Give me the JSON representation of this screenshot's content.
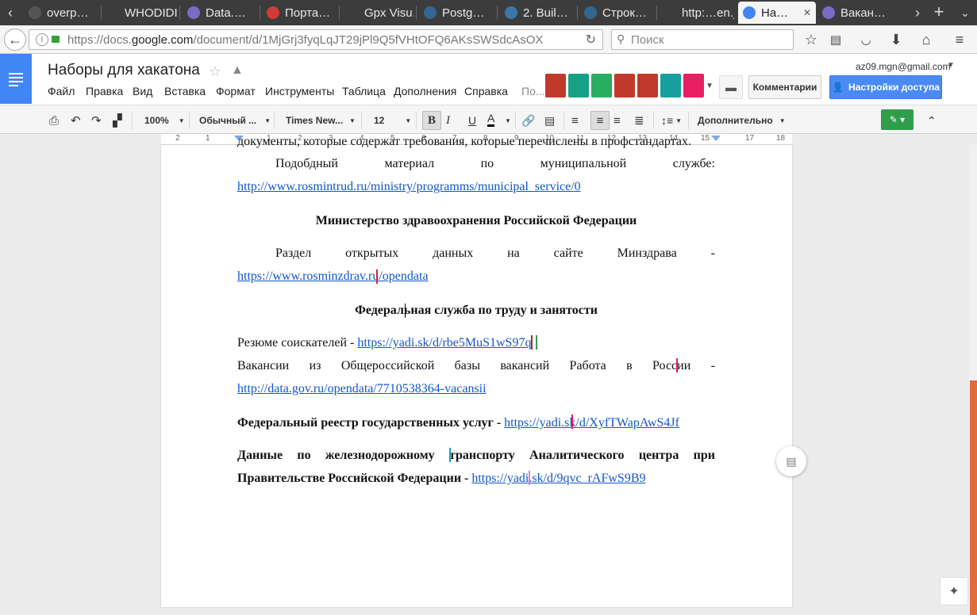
{
  "browser": {
    "tabs": [
      {
        "label": "overp…",
        "color": "#555555"
      },
      {
        "label": "WHODIDI…",
        "color": "#3c3c3c"
      },
      {
        "label": "Data.…",
        "color": "#7a6cc5"
      },
      {
        "label": "Порта…",
        "color": "#d33a3a"
      },
      {
        "label": "Gpx Visu…",
        "color": "#3c3c3c"
      },
      {
        "label": "Postg…",
        "color": "#336791"
      },
      {
        "label": "2. Buil…",
        "color": "#3b77a8"
      },
      {
        "label": "Строк…",
        "color": "#336791"
      },
      {
        "label": "http:…en.js",
        "color": "#3c3c3c"
      },
      {
        "label": "На…",
        "color": "#4285f4"
      },
      {
        "label": "Вакан…",
        "color": "#7a6cc5"
      }
    ],
    "url_prefix": "https://docs.",
    "url_domain": "google.com",
    "url_path": "/document/d/1MjGrj3fyqLqJT29jPl9Q5fVHtOFQ6AKsSWSdcAsOX",
    "search_placeholder": "Поиск"
  },
  "docs": {
    "title": "Наборы для хакатона",
    "account": "az09.mgn@gmail.com",
    "menu": [
      "Файл",
      "Правка",
      "Вид",
      "Вставка",
      "Формат",
      "Инструменты",
      "Таблица",
      "Дополнения",
      "Справка",
      "По..."
    ],
    "comments_label": "Комментарии",
    "share_label": "Настройки доступа",
    "addon_colors": [
      "#c0392b",
      "#16a085",
      "#27ae60",
      "#c0392b",
      "#c0392b",
      "#16a0a0",
      "#e91e63"
    ]
  },
  "toolbar": {
    "zoom": "100%",
    "style": "Обычный ...",
    "font": "Times New...",
    "size": "12",
    "more": "Дополнительно"
  },
  "ruler": {
    "ticks": [
      "2",
      "1",
      "1",
      "2",
      "3",
      "4",
      "5",
      "6",
      "7",
      "8",
      "9",
      "10",
      "11",
      "12",
      "13",
      "14",
      "15",
      "17",
      "18"
    ]
  },
  "doc": {
    "top_partial": "документы, которые содержат требования, которые перечислены в профстандартах.",
    "l1_words": [
      "Подобдный",
      "материал",
      "по",
      "муниципальной",
      "службе:"
    ],
    "l1_link": "http://www.rosmintrud.ru/ministry/programms/municipal_service/0",
    "h1": "Министерство здравоохранения Российской Федерации",
    "l2_words": [
      "Раздел",
      "открытых",
      "данных",
      "на",
      "сайте",
      "Минздрава",
      "-"
    ],
    "l2_link": "https://www.rosminzdrav.ru/opendata",
    "h2": "Федеральная служба по труду и занятости",
    "l3_text": "Резюме соискателей - ",
    "l3_link": "https://yadi.sk/d/rbe5MuS1wS97q",
    "l4_words": [
      "Вакансии",
      "из",
      "Общероссийской",
      "базы",
      "вакансий",
      "Работа",
      "в",
      "России",
      "-"
    ],
    "l4_link": "http://data.gov.ru/opendata/7710538364-vacansii",
    "l5_text": "Федеральный реестр государственных услуг - ",
    "l5_link": "https://yadi.sk/d/XyfTWapAwS4Jf",
    "l6_words": [
      "Данные",
      "по",
      "железнодорожному",
      "транспорту",
      "Аналитического",
      "центра",
      "при"
    ],
    "l7_text": "Правительстве Российской Федерации - ",
    "l7_link": "https://yadi.sk/d/9qvc_rAFwS9B9"
  }
}
